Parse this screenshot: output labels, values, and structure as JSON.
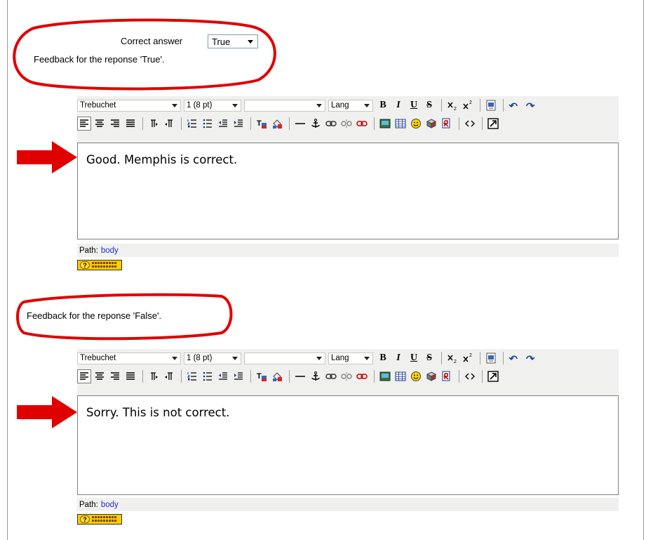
{
  "question": {
    "correct_answer_label": "Correct answer",
    "correct_answer_value": "True",
    "feedback_true_label": "Feedback for the reponse 'True'.",
    "feedback_false_label": "Feedback for the reponse 'False'."
  },
  "toolbar": {
    "font_family": "Trebuchet",
    "font_size": "1 (8 pt)",
    "style": "",
    "lang": "Lang",
    "bold": "B",
    "italic": "I",
    "underline": "U",
    "strike": "S"
  },
  "editors": [
    {
      "content": "Good.  Memphis is correct.",
      "path_label": "Path:",
      "path_value": "body"
    },
    {
      "content": "Sorry. This is not correct.",
      "path_label": "Path:",
      "path_value": "body"
    }
  ],
  "annotation_color": "#e00000"
}
